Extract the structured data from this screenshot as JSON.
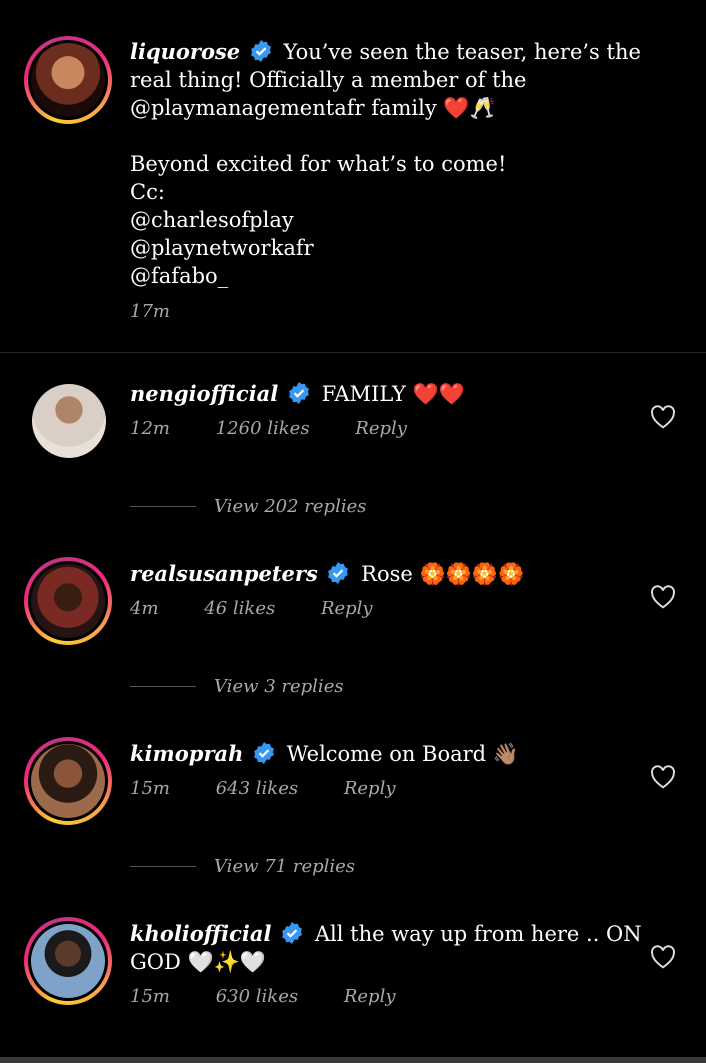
{
  "post": {
    "username": "liquorose",
    "caption_line1": "You’ve seen the teaser, here’s the real thing! Officially a member of the @playmanagementafr family ❤️🥂",
    "caption_line2": "Beyond excited for what’s to come!",
    "cc": "Cc:",
    "mentions": [
      "@charlesofplay",
      "@playnetworkafr",
      "@fafabo_"
    ],
    "time": "17m"
  },
  "comments": [
    {
      "username": "nengiofficial",
      "text": "FAMILY ❤️❤️",
      "time": "12m",
      "likes": "1260 likes",
      "reply": "Reply",
      "view_replies": "View 202 replies"
    },
    {
      "username": "realsusanpeters",
      "text": "Rose 🏵️🏵️🏵️🏵️",
      "time": "4m",
      "likes": "46 likes",
      "reply": "Reply",
      "view_replies": "View 3 replies"
    },
    {
      "username": "kimoprah",
      "text": "Welcome on Board 👋🏽",
      "time": "15m",
      "likes": "643 likes",
      "reply": "Reply",
      "view_replies": "View 71 replies"
    },
    {
      "username": "kholiofficial",
      "text": "All the way up from here .. ON GOD 🤍✨🤍",
      "time": "15m",
      "likes": "630 likes",
      "reply": "Reply"
    }
  ],
  "colors": {
    "verified": "#3897f0",
    "meta": "#a8a8a8",
    "background": "#000000"
  }
}
